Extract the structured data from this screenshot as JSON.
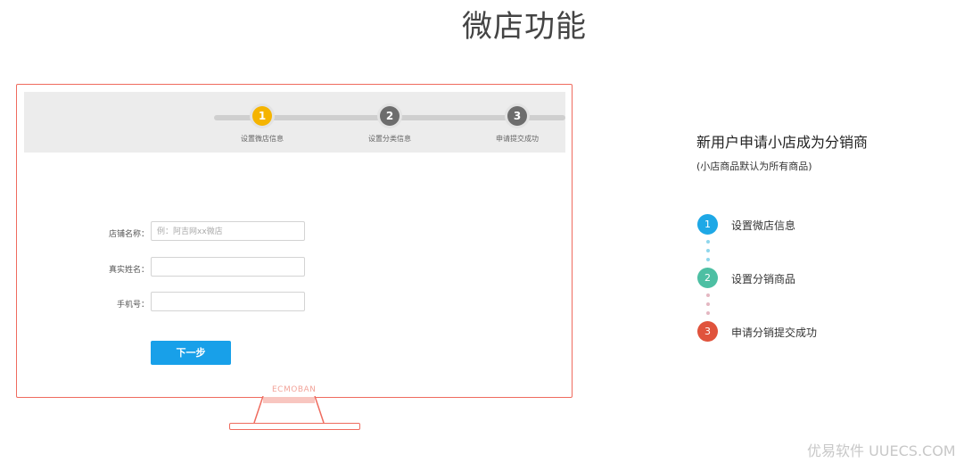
{
  "page": {
    "title": "微店功能"
  },
  "device": {
    "steps": [
      {
        "number": "1",
        "label": "设置微店信息",
        "state": "active"
      },
      {
        "number": "2",
        "label": "设置分类信息",
        "state": "inactive"
      },
      {
        "number": "3",
        "label": "申请提交成功",
        "state": "inactive"
      }
    ],
    "form": {
      "shop_name": {
        "label": "店铺名称：",
        "placeholder": "例：阿吉网xx微店",
        "value": ""
      },
      "real_name": {
        "label": "真实姓名：",
        "placeholder": "",
        "value": ""
      },
      "phone": {
        "label": "手机号：",
        "placeholder": "",
        "value": ""
      },
      "next_label": "下一步"
    },
    "watermark": "ECMOBAN"
  },
  "info": {
    "title": "新用户申请小店成为分销商",
    "subtitle": "(小店商品默认为所有商品)",
    "steps": [
      {
        "number": "1",
        "label": "设置微店信息",
        "color": "#1ea8e6"
      },
      {
        "number": "2",
        "label": "设置分销商品",
        "color": "#4dbfa3"
      },
      {
        "number": "3",
        "label": "申请分销提交成功",
        "color": "#e0533c"
      }
    ],
    "connector_colors": [
      "#8fd6ec",
      "#e4b7c2"
    ]
  },
  "footer": {
    "watermark": "优易软件 UUECS.COM"
  },
  "colors": {
    "accent": "#18a0e9",
    "frame": "#ef6b5e",
    "active_step": "#f5b400",
    "inactive_step": "#6d6d6d"
  }
}
